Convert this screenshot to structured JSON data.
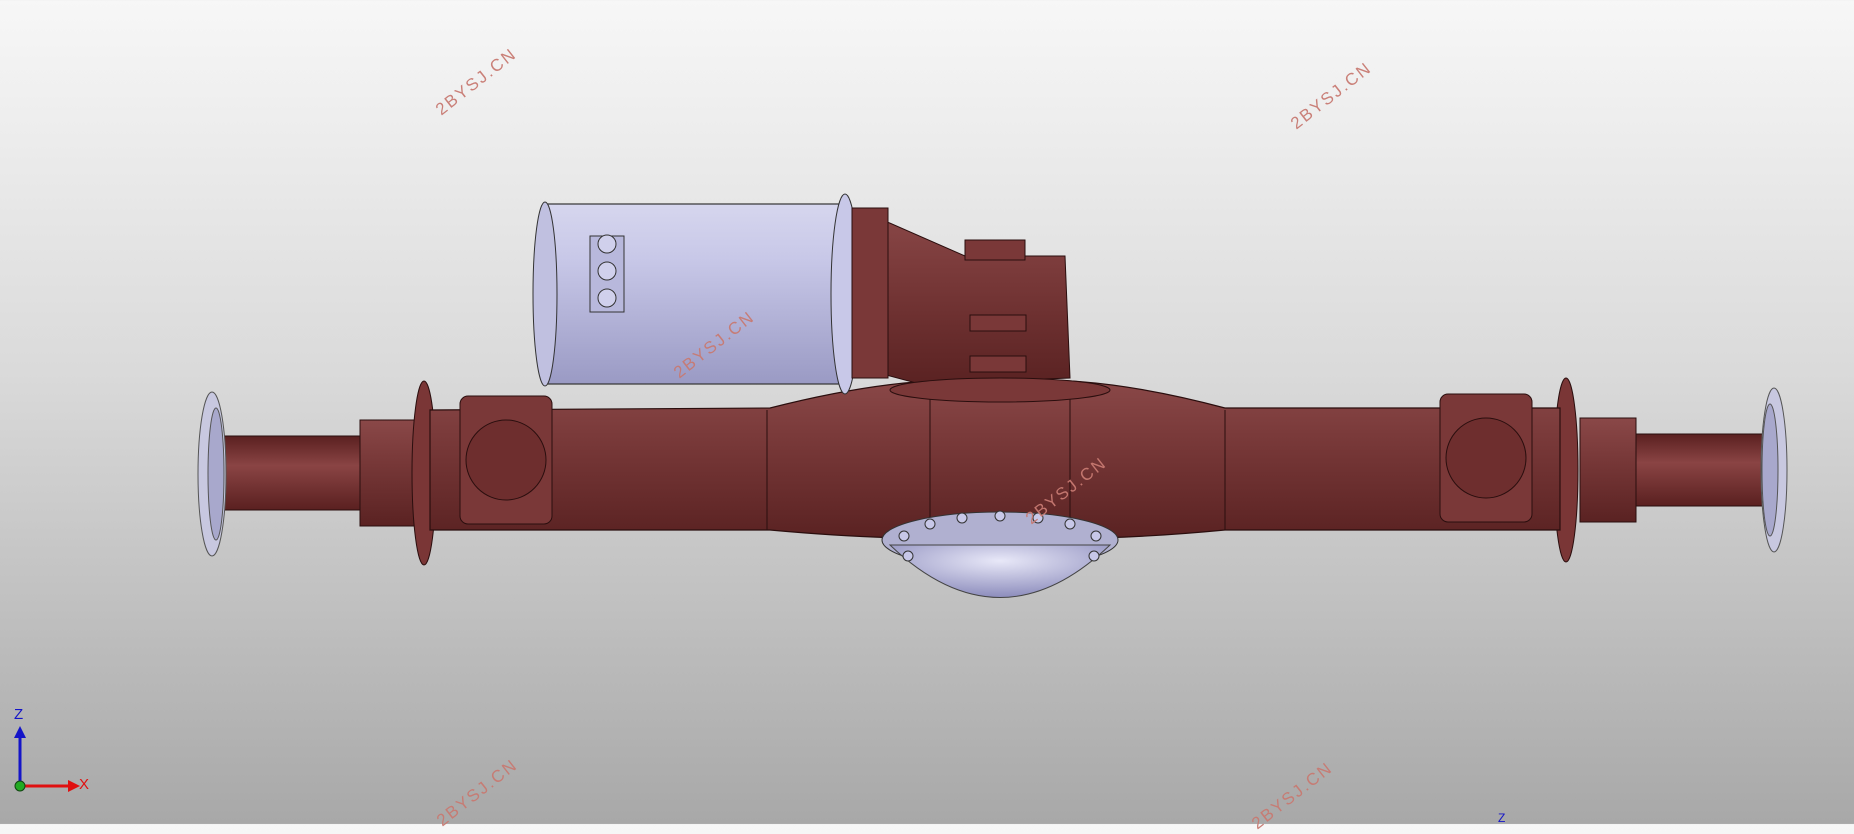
{
  "watermarks": [
    "2BYSJ.CN",
    "2BYSJ.CN",
    "2BYSJ.CN",
    "2BYSJ.CN",
    "2BYSJ.CN",
    "2BYSJ.CN"
  ],
  "triad": {
    "z_label": "Z",
    "x_label": "X",
    "z_color": "#1414c8",
    "x_color": "#e01010",
    "origin_color": "#22aa22"
  },
  "corner_label": "Z",
  "colors": {
    "housing": "#6e2e2e",
    "motor": "#b8b8dc",
    "background_top": "#f7f7f7",
    "background_bottom": "#a8a8a8"
  }
}
